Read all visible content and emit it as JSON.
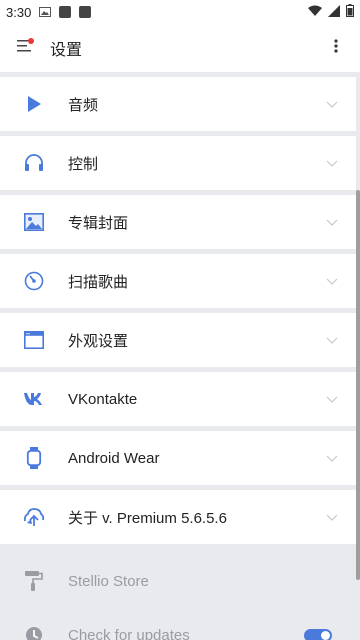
{
  "status_bar": {
    "time": "3:30"
  },
  "app_bar": {
    "title": "设置"
  },
  "settings": [
    {
      "label": "音频",
      "icon": "play-icon"
    },
    {
      "label": "控制",
      "icon": "headphones-icon"
    },
    {
      "label": "专辑封面",
      "icon": "image-icon"
    },
    {
      "label": "扫描歌曲",
      "icon": "scan-icon"
    },
    {
      "label": "外观设置",
      "icon": "window-icon"
    },
    {
      "label": "VKontakte",
      "icon": "vk-icon"
    },
    {
      "label": "Android Wear",
      "icon": "watch-icon"
    },
    {
      "label": "关于 v. Premium 5.6.5.6",
      "icon": "about-icon"
    }
  ],
  "extra": [
    {
      "label": "Stellio Store",
      "icon": "paint-roller-icon"
    },
    {
      "label": "Check for updates",
      "icon": "update-icon",
      "toggle_on": true
    }
  ],
  "colors": {
    "accent": "#4a7bdc",
    "background": "#e9eaee"
  }
}
